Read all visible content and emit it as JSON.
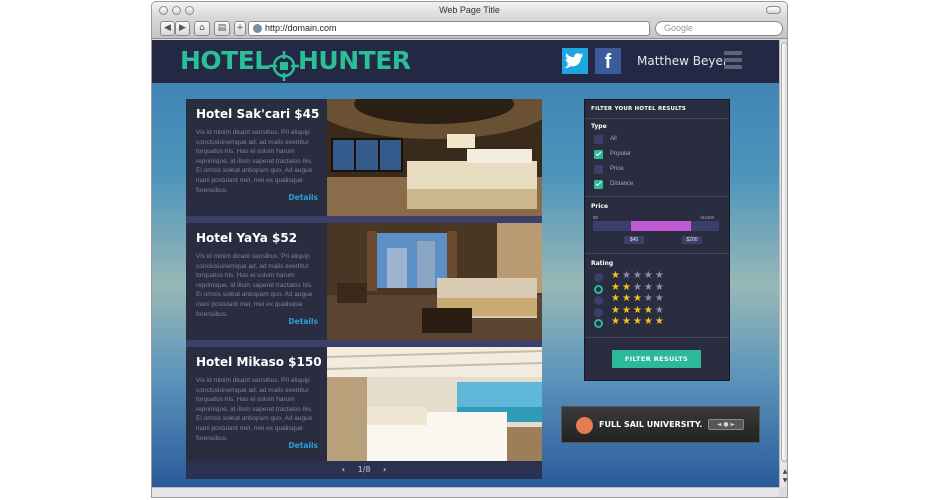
{
  "window": {
    "title": "Web Page Title"
  },
  "toolbar": {
    "url": "http://domain.com",
    "search_placeholder": "Google",
    "icons": [
      "back-arrow-icon",
      "forward-arrow-icon",
      "home-icon",
      "print-icon",
      "add-tab-icon"
    ]
  },
  "header": {
    "logo_part1": "HOTEL",
    "logo_part2": "HUNTER",
    "username": "Matthew Beyer",
    "facebook_glyph": "f",
    "accent_color": "#2bbf97"
  },
  "hotels": [
    {
      "title": "Hotel Sak'cari  $45",
      "description": "Vis id minim dicant sensibus. Pri aliquip conclusionemque ad, ad malis evertitur torquatos his. Has ei solum harum reprimique, id illum saperet tractatos his. Ei omnis soleat antiopam quo. Ad augue inani postulant mel, mei ex qualisque forensibus.",
      "details": "Details"
    },
    {
      "title": "Hotel YaYa  $52",
      "description": "Vis id minim dicant sensibus. Pri aliquip conclusionemque ad, ad malis evertitur torquatos his. Has ei solum harum reprimique, id illum saperet tractatos his. Ei omnis soleat antiopam quo. Ad augue inani postulant mel, mei ex qualisque forensibus.",
      "details": "Details"
    },
    {
      "title": "Hotel Mikaso  $150",
      "description": "Vis id minim dicant sensibus. Pri aliquip conclusionemque ad, ad malis evertitur torquatos his. Has ei solum harum reprimique, id illum saperet tractatos his. Ei omnis soleat antiopam quo. Ad augue inani postulant mel, mei ex qualisque forensibus.",
      "details": "Details"
    }
  ],
  "pager": {
    "label": "1/8"
  },
  "filter": {
    "heading": "FILTER YOUR HOTEL RESULTS",
    "type_label": "Type",
    "types": [
      {
        "label": "All",
        "checked": false
      },
      {
        "label": "Popular",
        "checked": true
      },
      {
        "label": "Price",
        "checked": false
      },
      {
        "label": "Distance",
        "checked": true
      }
    ],
    "price_label": "Price",
    "price_min": "$0",
    "price_max": "+$1000",
    "price_low": "$45",
    "price_high": "$200",
    "rating_label": "Rating",
    "ratings": [
      {
        "stars": 1,
        "selected": false
      },
      {
        "stars": 2,
        "selected": true
      },
      {
        "stars": 3,
        "selected": false
      },
      {
        "stars": 4,
        "selected": false
      },
      {
        "stars": 5,
        "selected": true
      }
    ],
    "button_label": "FILTER RESULTS",
    "slider_color": "#c35ad3"
  },
  "ad": {
    "text": "FULL SAIL UNIVERSITY.",
    "badge": "◄ ● ►"
  }
}
